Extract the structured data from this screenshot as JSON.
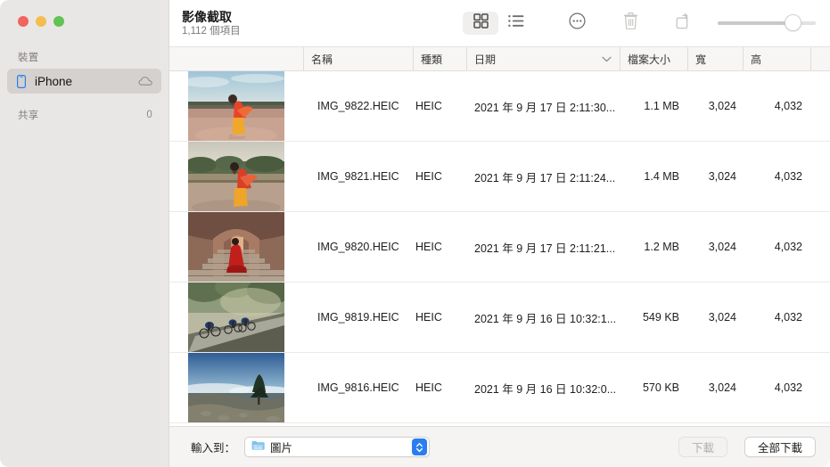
{
  "window": {
    "title": "影像截取",
    "subtitle": "1,112 個項目",
    "traffic_lights": {
      "close": "close-button",
      "minimize": "minimize-button",
      "zoom": "zoom-button"
    }
  },
  "sidebar": {
    "sections": [
      {
        "label": "裝置"
      },
      {
        "label": "共享",
        "count": "0"
      }
    ],
    "devices": [
      {
        "label": "iPhone",
        "selected": true,
        "icon": "iphone-icon",
        "accessory_icon": "cloud-icon"
      }
    ]
  },
  "toolbar": {
    "buttons": [
      {
        "name": "grid-view-button",
        "icon": "grid-icon",
        "active": true
      },
      {
        "name": "list-view-button",
        "icon": "list-icon",
        "active": false
      },
      {
        "name": "more-button",
        "icon": "ellipsis-circle-icon",
        "active": false
      },
      {
        "name": "delete-button",
        "icon": "trash-icon",
        "active": false,
        "disabled": true
      },
      {
        "name": "rotate-button",
        "icon": "rotate-icon",
        "active": false,
        "disabled": true
      }
    ],
    "slider": {
      "name": "thumbnail-size-slider",
      "value": 68,
      "min": 0,
      "max": 100
    }
  },
  "table": {
    "columns": [
      {
        "key": "thumbnail",
        "label": ""
      },
      {
        "key": "name",
        "label": "名稱"
      },
      {
        "key": "kind",
        "label": "種類"
      },
      {
        "key": "date",
        "label": "日期",
        "sorted": true,
        "sort_icon": "chevron-down-icon"
      },
      {
        "key": "size",
        "label": "檔案大小"
      },
      {
        "key": "width",
        "label": "寬"
      },
      {
        "key": "height",
        "label": "高"
      }
    ],
    "rows": [
      {
        "name": "IMG_9822.HEIC",
        "kind": "HEIC",
        "date": "2021 年 9 月 17 日 2:11:30...",
        "size": "1.1 MB",
        "width": "3,024",
        "height": "4,032",
        "thumbnail": "woman-red-sari-plaza"
      },
      {
        "name": "IMG_9821.HEIC",
        "kind": "HEIC",
        "date": "2021 年 9 月 17 日 2:11:24...",
        "size": "1.4 MB",
        "width": "3,024",
        "height": "4,032",
        "thumbnail": "woman-red-sari-garden"
      },
      {
        "name": "IMG_9820.HEIC",
        "kind": "HEIC",
        "date": "2021 年 9 月 17 日 2:11:21...",
        "size": "1.2 MB",
        "width": "3,024",
        "height": "4,032",
        "thumbnail": "woman-red-dress-stairs"
      },
      {
        "name": "IMG_9819.HEIC",
        "kind": "HEIC",
        "date": "2021 年 9 月 16 日 10:32:1...",
        "size": "549 KB",
        "width": "3,024",
        "height": "4,032",
        "thumbnail": "cyclists-forest-road"
      },
      {
        "name": "IMG_9816.HEIC",
        "kind": "HEIC",
        "date": "2021 年 9 月 16 日 10:32:0...",
        "size": "570 KB",
        "width": "3,024",
        "height": "4,032",
        "thumbnail": "tree-above-clouds"
      }
    ]
  },
  "bottom_bar": {
    "import_label": "輸入到：",
    "destination": {
      "value": "圖片",
      "icon": "folder-icon",
      "stepper_icon": "updown-chevron-icon"
    },
    "download_button": {
      "label": "下載",
      "disabled": true
    },
    "download_all_button": {
      "label": "全部下載",
      "disabled": false
    }
  },
  "colors": {
    "sidebar_bg": "#e9e7e6",
    "selection": "#d4d1cf",
    "accent": "#2b7ef0",
    "header_bg": "#f7f6f5",
    "bottom_bg": "#f5f4f3",
    "traffic_red": "#f0655c",
    "traffic_yellow": "#f4bd4e",
    "traffic_green": "#60c353"
  }
}
